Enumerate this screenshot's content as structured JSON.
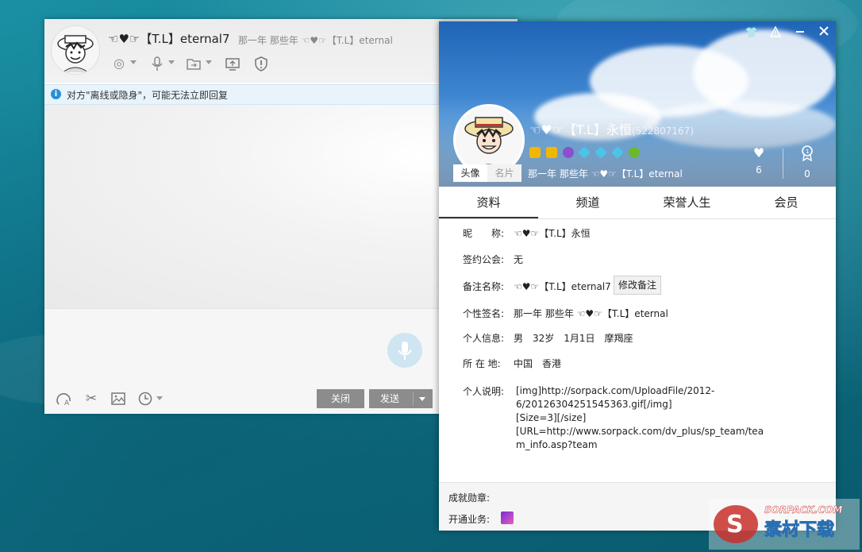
{
  "chat": {
    "contact_name": "☜♥☞【T.L】eternal7",
    "signature": "那一年 那些年 ☜♥☞【T.L】eternal",
    "notice": "对方\"离线或隐身\"，可能无法立即回复",
    "close_label": "关闭",
    "send_label": "发送",
    "toolbar_icons": [
      "video-icon",
      "mic-icon",
      "file-icon",
      "remote-icon",
      "security-icon"
    ],
    "bottom_icons": [
      "font-icon",
      "scissors-icon",
      "image-icon",
      "history-icon"
    ]
  },
  "profile": {
    "name": "☜♥☞【T.L】永恒",
    "qq": "(522807167)",
    "signature": "那一年 那些年 ☜♥☞【T.L】eternal",
    "like_count": "6",
    "rank_count": "0",
    "avatar_tabs": [
      "头像",
      "名片"
    ],
    "tabs": [
      "资料",
      "频道",
      "荣誉人生",
      "会员"
    ],
    "fields": {
      "nickname_label": "昵　　称:",
      "nickname": "☜♥☞【T.L】永恒",
      "guild_label": "签约公会:",
      "guild": "无",
      "remark_label": "备注名称:",
      "remark": "☜♥☞【T.L】eternal7",
      "edit_remark": "修改备注",
      "sig_label": "个性签名:",
      "sig": "那一年 那些年 ☜♥☞【T.L】eternal",
      "info_label": "个人信息:",
      "info": "男　32岁　1月1日　摩羯座",
      "location_label": "所 在 地:",
      "location": "中国　香港",
      "about_label": "个人说明:",
      "about_lines": [
        "[img]http://sorpack.com/UploadFile/2012-",
        "6/20126304251545363.gif[/img]",
        "[Size=3][/size]",
        "[URL=http://www.sorpack.com/dv_plus/sp_team/tea",
        "m_info.asp?team"
      ]
    },
    "achievement_label": "成就勋章:",
    "services_label": "开通业务:"
  },
  "watermark": {
    "top": "SORPACK.COM",
    "bottom": "素材下载"
  }
}
